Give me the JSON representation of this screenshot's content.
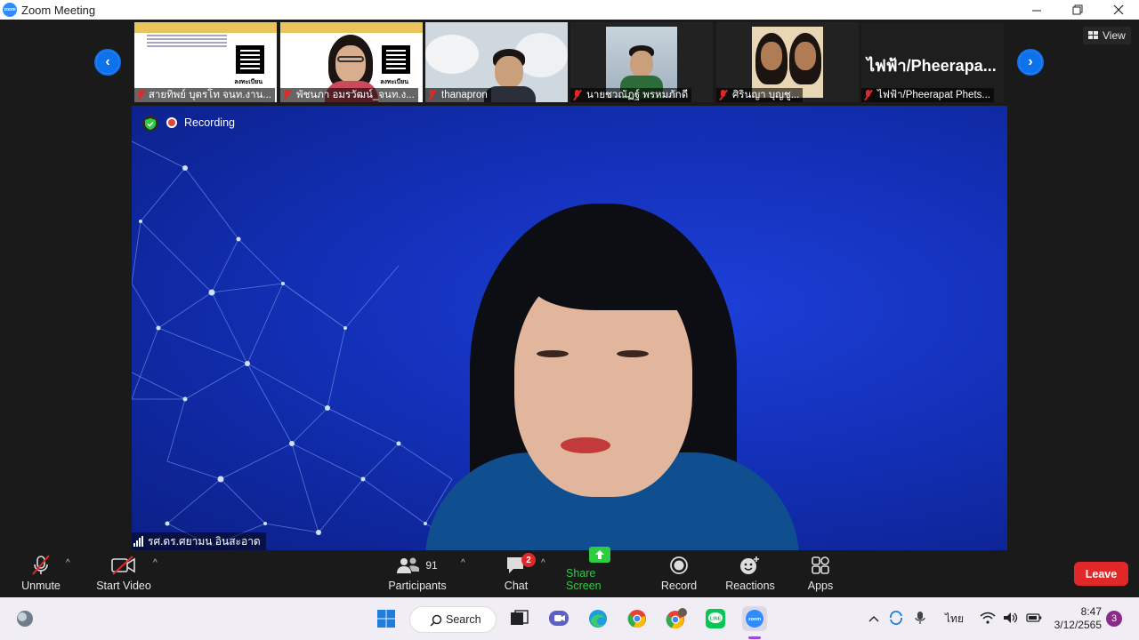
{
  "window": {
    "title": "Zoom Meeting",
    "app_icon_text": "zoom"
  },
  "view_button": {
    "label": "View"
  },
  "gallery": {
    "participants": [
      {
        "name": "สายทิพย์ บุตรโท จนท.งาน..."
      },
      {
        "name": "พัชนภา อมรวัฒน์_จนท.ง..."
      },
      {
        "name": "thanapron"
      },
      {
        "name": "นายชวณัฏฐ์ พรหมภักดี"
      },
      {
        "name": "ศิรินญา บุญชู..."
      },
      {
        "name": "ไฟฟ้า/Pheerapat Phets...",
        "display_text": "ไฟฟ้า/Pheerapa..."
      }
    ],
    "poster_caption": "ลงทะเบียน"
  },
  "meeting": {
    "recording_label": "Recording",
    "active_speaker": "รศ.ดร.ศยามน อินสะอาด"
  },
  "toolbar": {
    "unmute": "Unmute",
    "start_video": "Start Video",
    "participants": "Participants",
    "participants_count": "91",
    "chat": "Chat",
    "chat_badge": "2",
    "share_screen": "Share Screen",
    "record": "Record",
    "reactions": "Reactions",
    "apps": "Apps",
    "leave": "Leave"
  },
  "taskbar": {
    "search_label": "Search",
    "language": "ไทย",
    "time": "8:47",
    "date": "3/12/2565",
    "notification_count": "3"
  },
  "colors": {
    "accent_blue": "#0e72ed",
    "leave_red": "#e02828",
    "share_green": "#2ecc40",
    "background_blue": "#1330b8"
  }
}
